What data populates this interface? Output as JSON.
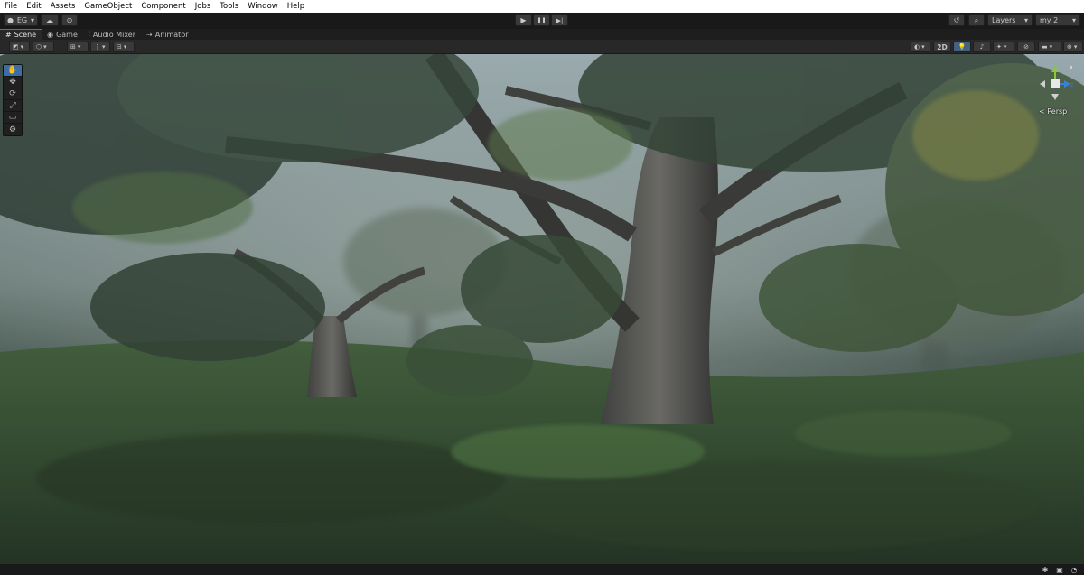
{
  "menu": [
    "File",
    "Edit",
    "Assets",
    "GameObject",
    "Component",
    "Jobs",
    "Tools",
    "Window",
    "Help"
  ],
  "toolbar": {
    "account_label": "EG",
    "account_icon": "account-icon",
    "cloud_icon": "cloud-icon",
    "collab_icon": "collab-icon",
    "play_icon": "▶",
    "pause_icon": "❚❚",
    "step_icon": "▶|",
    "history_icon": "↺",
    "search_icon": "⌕",
    "layers_label": "Layers",
    "layout_label": "my 2"
  },
  "tabs": [
    {
      "label": "Scene",
      "icon": "#"
    },
    {
      "label": "Game",
      "icon": "◉"
    },
    {
      "label": "Audio Mixer",
      "icon": "⫶"
    },
    {
      "label": "Animator",
      "icon": "⇢"
    }
  ],
  "scene_toolbar": {
    "twod_label": "2D"
  },
  "tools": [
    "✋",
    "✥",
    "⟳",
    "⤢",
    "▭",
    "⚙"
  ],
  "gizmo": {
    "y_label": "y",
    "z_label": "z",
    "persp_label": "< Persp"
  },
  "colors": {
    "accent": "#3a79bb",
    "menubar": "#ffffff",
    "editor_bg": "#191919"
  }
}
